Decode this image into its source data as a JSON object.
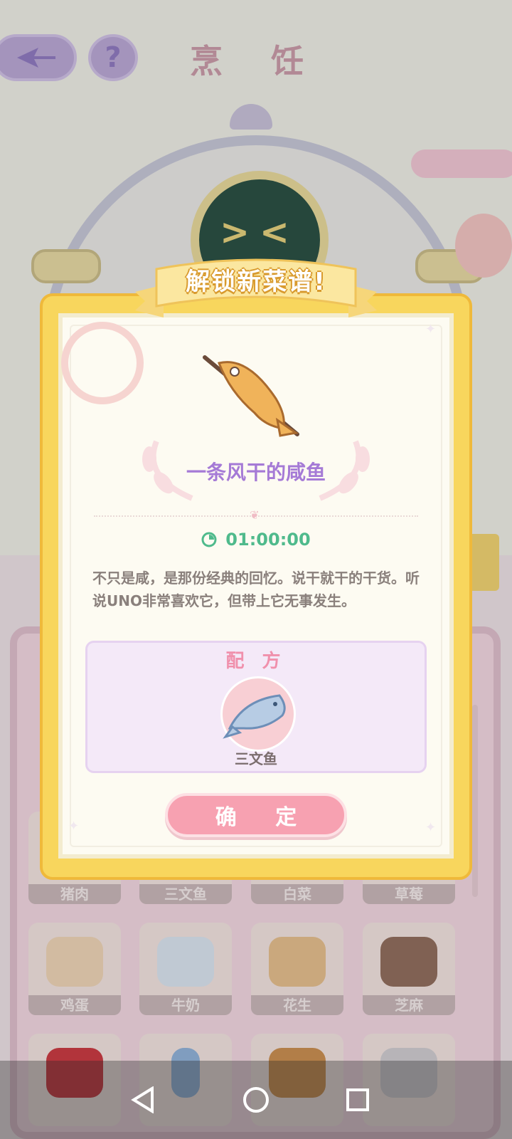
{
  "header": {
    "title": "烹 饪",
    "back_icon": "back-arrow-icon",
    "help_label": "?"
  },
  "dialog": {
    "banner_title": "解锁新菜谱!",
    "dish_name": "一条风干的咸鱼",
    "timer": "01:00:00",
    "description": "不只是咸，是那份经典的回忆。说干就干的干货。听说UNO非常喜欢它，但带上它无事发生。",
    "recipe_title": "配 方",
    "ingredient": "三文鱼",
    "confirm_label": "确 定"
  },
  "ingredients_grid": [
    {
      "label": "猪肉"
    },
    {
      "label": "三文鱼"
    },
    {
      "label": "白菜"
    },
    {
      "label": "草莓"
    },
    {
      "label": "鸡蛋"
    },
    {
      "label": "牛奶"
    },
    {
      "label": "花生"
    },
    {
      "label": "芝麻"
    }
  ],
  "colors": {
    "dialog_frame": "#f8d65d",
    "dish_name": "#a57ad6",
    "timer": "#4fba8c",
    "confirm_button": "#f7a1b1"
  }
}
